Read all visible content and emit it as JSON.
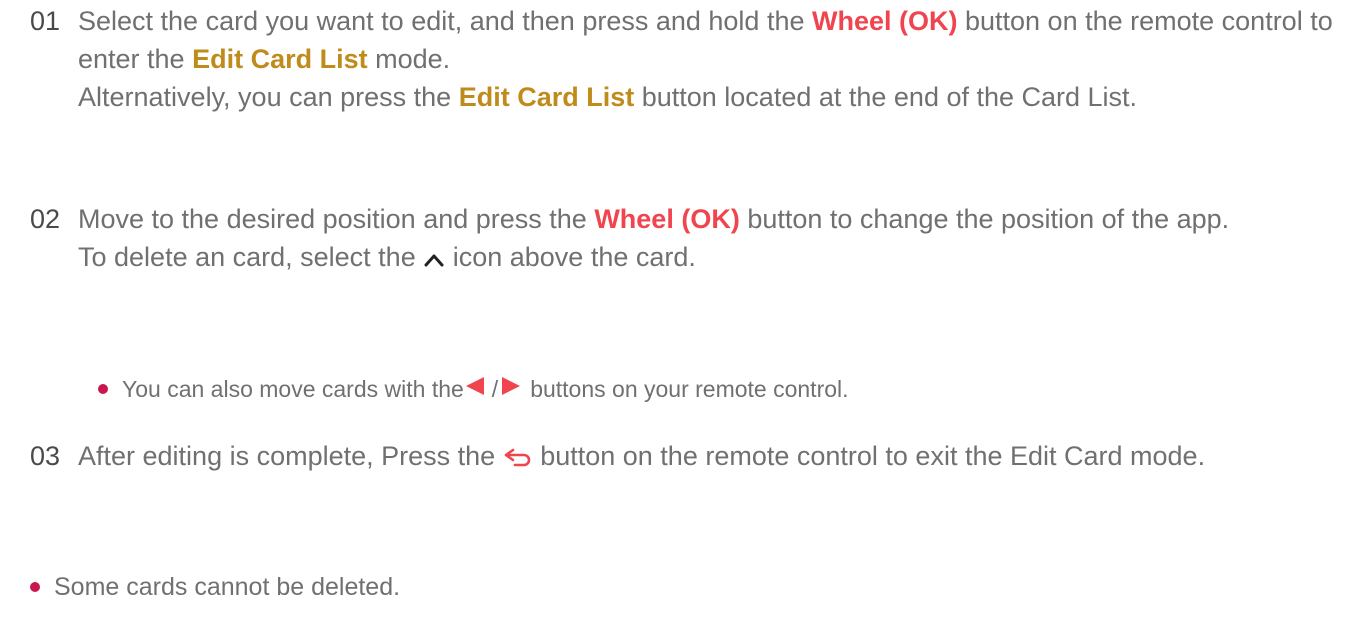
{
  "steps": [
    {
      "number": "01",
      "line1_pre": "Select the card you want to edit, and then press and hold the ",
      "line1_bold": "Wheel (OK)",
      "line1_post": " button on the remote control to enter the ",
      "line1_bold2": "Edit Card List",
      "line1_post2": " mode.",
      "line2_pre": "Alternatively, you can press the ",
      "line2_bold": "Edit Card List",
      "line2_post": " button located at the end of the Card List."
    },
    {
      "number": "02",
      "line1_pre": "Move to the desired position and press the ",
      "line1_bold": "Wheel (OK)",
      "line1_post": " button to change the position of the app.",
      "line2_pre": "To delete an card, select the ",
      "line2_post": " icon above the card.",
      "bullet_pre": "You can also move cards with the ",
      "bullet_post": " buttons on your remote control."
    },
    {
      "number": "03",
      "line1_pre": "After editing is complete, Press the ",
      "line1_post": " button on the remote control to exit the Edit Card mode."
    }
  ],
  "note": "Some cards cannot be deleted.",
  "icons": {
    "up": "chevron-up-icon",
    "left": "arrow-left-icon",
    "right": "arrow-right-icon",
    "back": "back-icon"
  },
  "colors": {
    "accent_red": "#f0454e",
    "accent_gold": "#bf8c1c",
    "bullet": "#c8174f",
    "text": "#707070"
  }
}
